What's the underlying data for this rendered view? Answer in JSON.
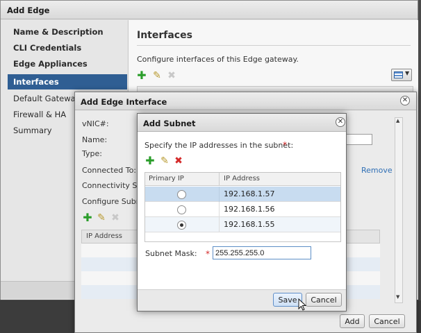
{
  "add_edge": {
    "title": "Add Edge",
    "close_glyph": "✕",
    "nav": [
      {
        "label": "Name & Description"
      },
      {
        "label": "CLI Credentials"
      },
      {
        "label": "Edge Appliances"
      },
      {
        "label": "Interfaces"
      },
      {
        "label": "Default Gateway"
      },
      {
        "label": "Firewall & HA"
      },
      {
        "label": "Summary"
      }
    ],
    "pane_title": "Interfaces",
    "pane_desc": "Configure interfaces of this Edge gateway."
  },
  "edge_interface": {
    "title": "Add Edge Interface",
    "vnic_label": "vNIC#:",
    "name_label": "Name:",
    "type_label": "Type:",
    "connected_label": "Connected To:",
    "remove_link": "Remove",
    "connectivity_label": "Connectivity Sta",
    "configure_label": "Configure Subne",
    "grid_header": "IP Address",
    "add_button": "Add",
    "cancel_button": "Cancel"
  },
  "add_subnet": {
    "title": "Add Subnet",
    "instruction": "Specify the IP addresses in the subnet:",
    "required_mark": "*",
    "columns": [
      "Primary IP",
      "IP Address"
    ],
    "rows": [
      {
        "primary": false,
        "ip": "192.168.1.57",
        "selected": true
      },
      {
        "primary": false,
        "ip": "192.168.1.56",
        "selected": false
      },
      {
        "primary": true,
        "ip": "192.168.1.55",
        "selected": false
      }
    ],
    "subnet_mask_label": "Subnet Mask:",
    "subnet_mask_value": "255.255.255.0",
    "save_button": "Save",
    "cancel_button": "Cancel"
  },
  "colors": {
    "nav_selected": "#2f5e93",
    "row_selected": "#c8dcf0",
    "add_icon": "#2a9d2a",
    "delete_icon": "#d42a2a",
    "link": "#2f6fb5"
  },
  "icons": [
    "plus-icon",
    "pencil-icon",
    "delete-icon",
    "close-icon",
    "grid-view-icon",
    "chevron-down-icon",
    "mouse-cursor-icon"
  ]
}
